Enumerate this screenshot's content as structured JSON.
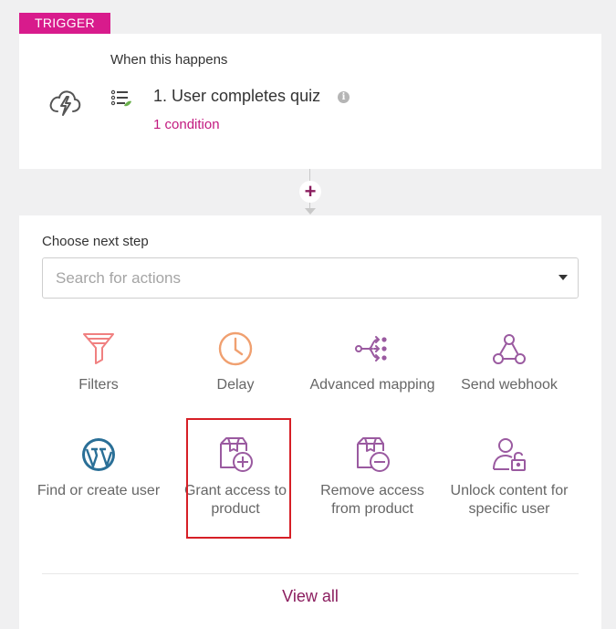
{
  "trigger": {
    "badge": "TRIGGER",
    "when_label": "When this happens",
    "title": "1. User completes quiz",
    "info": "i",
    "condition": "1 condition"
  },
  "connector": {
    "add": "+"
  },
  "actions": {
    "choose_label": "Choose next step",
    "search_placeholder": "Search for actions",
    "tiles": [
      {
        "label": "Filters",
        "icon": "funnel-icon",
        "color": "#f08080"
      },
      {
        "label": "Delay",
        "icon": "clock-icon",
        "color": "#f0a070"
      },
      {
        "label": "Advanced mapping",
        "icon": "mapping-icon",
        "color": "#9a5aa0"
      },
      {
        "label": "Send webhook",
        "icon": "webhook-icon",
        "color": "#9a5aa0"
      },
      {
        "label": "Find or create user",
        "icon": "wordpress-icon",
        "color": "#2a6f97"
      },
      {
        "label": "Grant access to product",
        "icon": "box-plus-icon",
        "color": "#9a5aa0"
      },
      {
        "label": "Remove access from product",
        "icon": "box-minus-icon",
        "color": "#9a5aa0"
      },
      {
        "label": "Unlock content for specific user",
        "icon": "user-lock-icon",
        "color": "#9a5aa0"
      }
    ],
    "view_all": "View all"
  },
  "colors": {
    "brand_pink": "#d81b8c",
    "brand_plum": "#8b1e5f",
    "highlight_red": "#d61f26"
  }
}
